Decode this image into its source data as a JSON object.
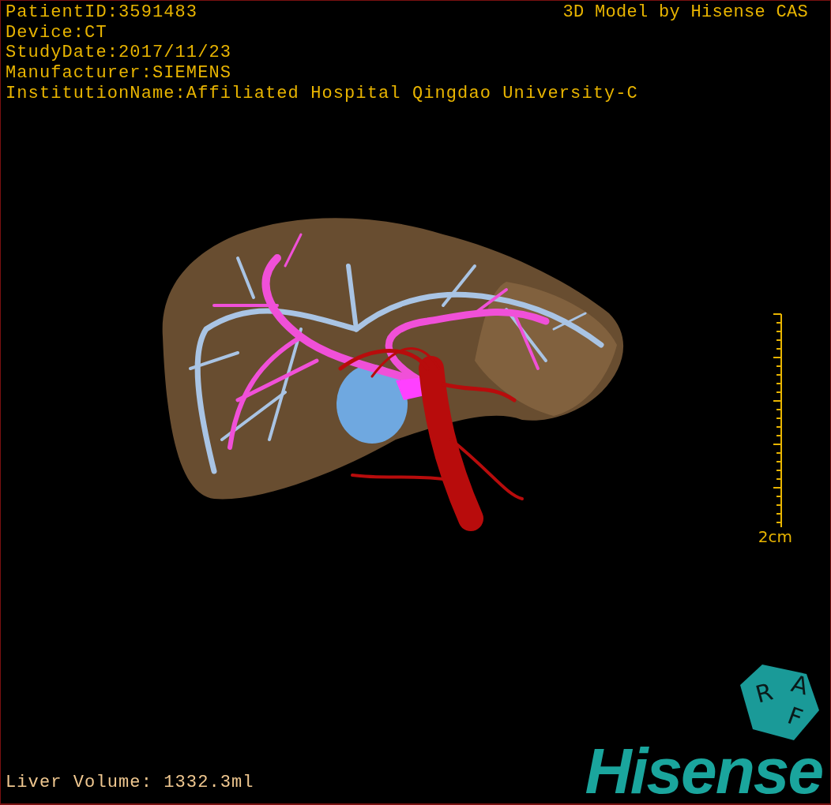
{
  "viewer": {
    "info_lines": [
      "PatientID:3591483",
      "Device:CT",
      "StudyDate:2017/11/23",
      "Manufacturer:SIEMENS",
      "InstitutionName:Affiliated Hospital Qingdao University-C"
    ],
    "title": "3D Model by Hisense CAS"
  },
  "scale_bar": {
    "label": "2cm"
  },
  "liver_volume": "Liver Volume: 1332.3ml",
  "orientation_cube": {
    "labels": [
      "R",
      "A",
      "F"
    ]
  },
  "logo": "Hisense"
}
